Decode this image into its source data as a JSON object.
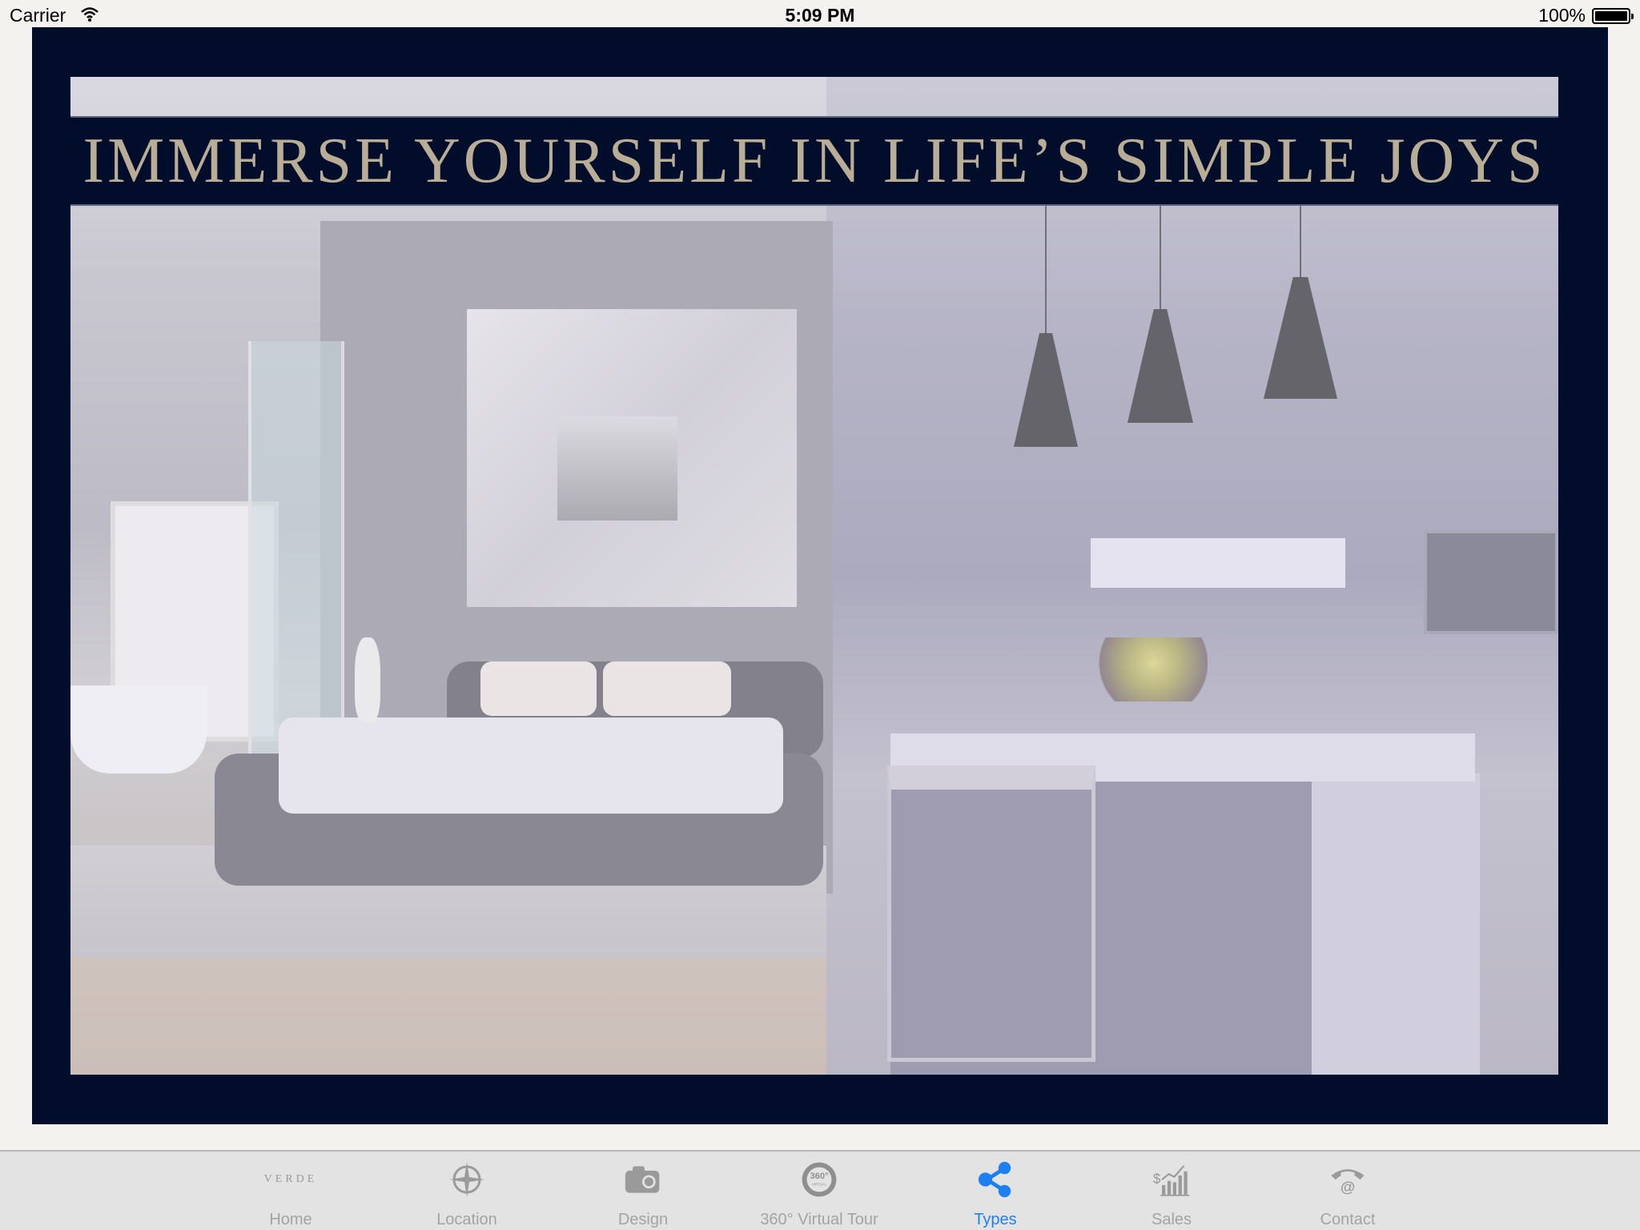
{
  "status_bar": {
    "carrier": "Carrier",
    "time": "5:09 PM",
    "battery": "100%"
  },
  "banner": {
    "headline": "IMMERSE YOURSELF IN LIFE’S SIMPLE JOYS"
  },
  "colors": {
    "frame": "#020d2c",
    "headline": "#b9ad96",
    "tab_active": "#1e7ff3",
    "tab_inactive": "#a3a3a3"
  },
  "tab_bar": {
    "tabs": [
      {
        "label": "Home",
        "icon": "verde-logo-icon",
        "logo_text": "VERDE",
        "active": false
      },
      {
        "label": "Location",
        "icon": "compass-icon",
        "active": false
      },
      {
        "label": "Design",
        "icon": "camera-icon",
        "active": false
      },
      {
        "label": "360° Virtual Tour",
        "icon": "virtual-tour-360-icon",
        "active": false
      },
      {
        "label": "Types",
        "icon": "share-nodes-icon",
        "active": true
      },
      {
        "label": "Sales",
        "icon": "sales-chart-icon",
        "active": false
      },
      {
        "label": "Contact",
        "icon": "contact-phone-icon",
        "active": false
      }
    ]
  }
}
